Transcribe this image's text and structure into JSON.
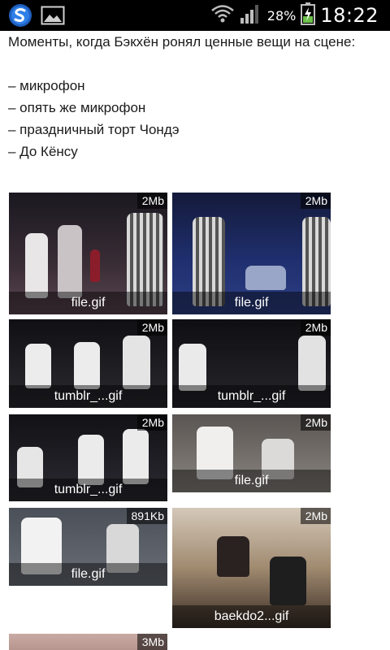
{
  "status_bar": {
    "battery_percent": "28%",
    "time": "18:22",
    "icons": [
      "app-s-icon",
      "gallery-icon",
      "wifi-icon",
      "signal-icon",
      "battery-charging-icon"
    ]
  },
  "post": {
    "intro": "Моменты, когда Бэкхён ронял ценные вещи на сцене:",
    "items": [
      "– микрофон",
      "– опять же микрофон",
      "– праздничный торт Чондэ",
      "– До Кёнсу"
    ]
  },
  "attachments": [
    {
      "size": "2Mb",
      "name": "file.gif"
    },
    {
      "size": "2Mb",
      "name": "file.gif"
    },
    {
      "size": "2Mb",
      "name": "tumblr_...gif"
    },
    {
      "size": "2Mb",
      "name": "tumblr_...gif"
    },
    {
      "size": "2Mb",
      "name": "tumblr_...gif"
    },
    {
      "size": "2Mb",
      "name": "file.gif"
    },
    {
      "size": "891Kb",
      "name": "file.gif"
    },
    {
      "size": "2Mb",
      "name": "baekdo2...gif"
    },
    {
      "size": "3Mb",
      "name": ""
    }
  ]
}
